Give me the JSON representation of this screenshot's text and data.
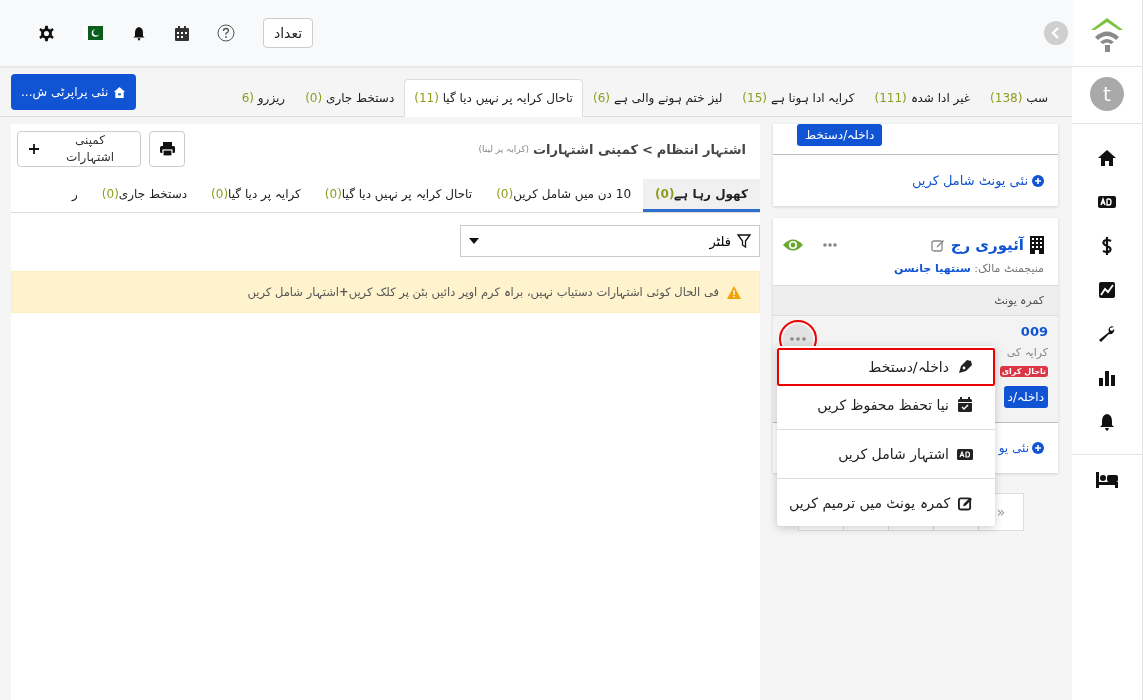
{
  "header": {
    "count_button": "تعداد"
  },
  "sidebar": {
    "avatar": "t"
  },
  "tabs": [
    {
      "label": "سب",
      "count": "(138)",
      "selected": false
    },
    {
      "label": "غیر ادا شدہ",
      "count": "(111)",
      "selected": false
    },
    {
      "label": "کرایہ ادا ہونا ہے",
      "count": "(15)",
      "selected": false
    },
    {
      "label": "لیز ختم ہونے والی ہے",
      "count": "(6)",
      "selected": false
    },
    {
      "label": "تاحال کرایہ پر نہیں دیا گیا",
      "count": "(11)",
      "selected": true
    },
    {
      "label": "دستخط جاری",
      "count": "(0)",
      "selected": false
    },
    {
      "label": "ریزرو",
      "count": "(6",
      "selected": false
    }
  ],
  "new_property_button": "نئی پراپرٹی ش...",
  "panel": {
    "breadcrumb": [
      "اشتہار انتظام",
      ">",
      "کمپنی اشتہارات"
    ],
    "breadcrumb_note": "(کرایہ پر لینا)",
    "add_button": "کمپنی اشتہارات",
    "sub_tabs": [
      {
        "label": "کھول رہا ہے",
        "count": "(0)",
        "selected": true
      },
      {
        "label": "10 دن میں شامل کریں",
        "count": "(0)",
        "selected": false
      },
      {
        "label": "تاحال کرایہ پر نہیں دیا گیا",
        "count": "(0)",
        "selected": false
      },
      {
        "label": "کرایہ پر دیا گیا",
        "count": "(0)",
        "selected": false
      },
      {
        "label": "دستخط جاری",
        "count": "(0)",
        "selected": false
      },
      {
        "label": "ر",
        "selected": false
      }
    ],
    "filter": "فلٹر",
    "alert": "فی الحال کوئی اشتہارات دستیاب نہیں، براہ کرم اوپر دائیں بٹن پر کلک کریں**+**اشتہار شامل کریں"
  },
  "cards": {
    "top": {
      "button": "داخلہ/دستخط",
      "add_unit": "نئی یونٹ شامل کریں"
    },
    "property": {
      "name": "آئیوری رج",
      "manager_label": "منیجمنٹ مالک:",
      "manager": "سنتھیا جانسن",
      "section": "کمرہ یونٹ",
      "unit": {
        "number": "009",
        "status_text": "کرایہ کی",
        "badge": "تاحال کرای",
        "button": "داخلہ/د",
        "menu_open": true
      },
      "add_unit": "نئی یو"
    },
    "pagination": {
      "last": "»"
    }
  },
  "menu": [
    {
      "kind": "sign",
      "label": "داخلہ/دستخط",
      "highlighted": true,
      "divider_before": false
    },
    {
      "kind": "reserve",
      "label": "نیا تحفظ محفوظ کریں",
      "highlighted": false,
      "divider_before": false
    },
    {
      "kind": "ad",
      "label": "اشتہار شامل کریں",
      "highlighted": false,
      "divider_before": true
    },
    {
      "kind": "edit",
      "label": "کمرہ یونٹ میں ترمیم کریں",
      "highlighted": false,
      "divider_before": true
    }
  ]
}
